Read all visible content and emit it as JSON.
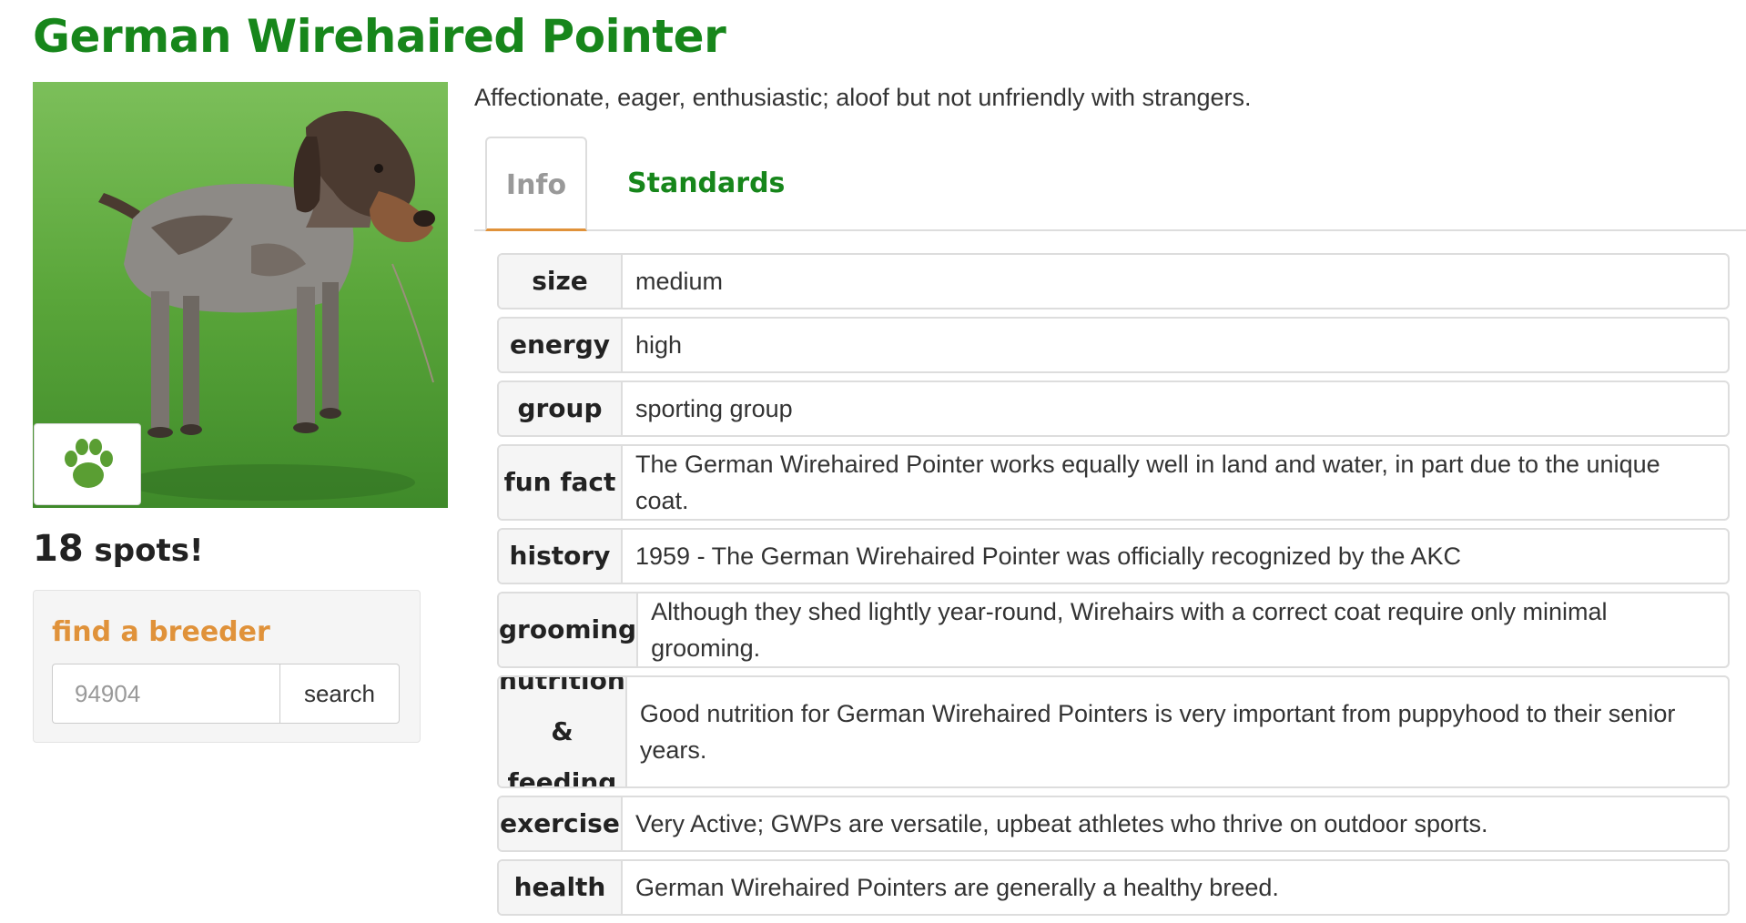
{
  "page": {
    "title": "German Wirehaired Pointer",
    "tagline": "Affectionate, eager, enthusiastic; aloof but not unfriendly with strangers."
  },
  "sidebar": {
    "spots_count": "18",
    "spots_label": "spots!",
    "paw_icon": "paw-icon",
    "breeder": {
      "title": "find a breeder",
      "zip_placeholder": "94904",
      "search_label": "search"
    }
  },
  "tabs": [
    {
      "label": "Info",
      "active": true
    },
    {
      "label": "Standards",
      "active": false
    }
  ],
  "info_rows": [
    {
      "label": "size",
      "value": "medium"
    },
    {
      "label": "energy",
      "value": "high"
    },
    {
      "label": "group",
      "value": "sporting group"
    },
    {
      "label": "fun fact",
      "value": "The German Wirehaired Pointer works equally well in land and water, in part due to the unique coat."
    },
    {
      "label": "history",
      "value": "1959 - The German Wirehaired Pointer was officially recognized by the AKC"
    },
    {
      "label": "grooming",
      "value": "Although they shed lightly year-round, Wirehairs with a correct coat require only minimal grooming."
    },
    {
      "label": "nutrition & feeding",
      "value": "Good nutrition for German Wirehaired Pointers is very important from puppyhood to their senior years."
    },
    {
      "label": "exercise",
      "value": "Very Active; GWPs are versatile, upbeat athletes who thrive on outdoor sports."
    },
    {
      "label": "health",
      "value": "German Wirehaired Pointers are generally a healthy breed."
    }
  ],
  "colors": {
    "brand_green": "#17861b",
    "accent_orange": "#e0923a",
    "grass_green": "#5faa3e"
  }
}
